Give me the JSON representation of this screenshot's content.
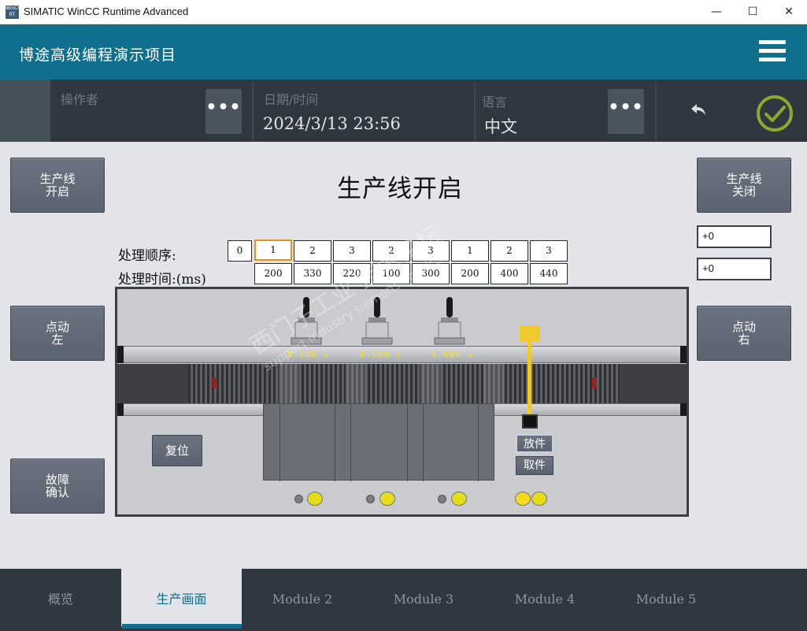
{
  "window": {
    "icon_text": "WinCC RT",
    "title": "SIMATIC WinCC Runtime Advanced",
    "minimize": "—",
    "maximize": "☐",
    "close": "✕"
  },
  "header": {
    "project_title": "博途高级编程演示项目"
  },
  "infobar": {
    "operator_label": "操作者",
    "operator_button": "•••",
    "datetime_label": "日期/时间",
    "datetime_value": "2024/3/13 23:56",
    "language_label": "语言",
    "language_value": "中文",
    "language_button": "•••"
  },
  "main": {
    "title": "生产线开启",
    "left_buttons": {
      "line_start": "生产线\n开启",
      "jog_left": "点动\n左",
      "fault_ack": "故障\n确认"
    },
    "right_buttons": {
      "line_stop": "生产线\n关闭",
      "jog_right": "点动\n右"
    },
    "right_fields": [
      "+0",
      "+0"
    ],
    "sequence_label": "处理顺序:",
    "time_label": "处理时间:(ms)",
    "sequence_index": "0",
    "sequence": [
      "1",
      "2",
      "3",
      "2",
      "3",
      "1",
      "2",
      "3"
    ],
    "times": [
      "200",
      "330",
      "220",
      "100",
      "300",
      "200",
      "400",
      "440"
    ]
  },
  "machine": {
    "timers": [
      "0.000  s",
      "0.000  s",
      "0.000  s"
    ],
    "reset_label": "复位",
    "place_label": "放件",
    "pick_label": "取件"
  },
  "watermark": {
    "line1": "西门子工业 技术论坛",
    "line2": "support.industry.siemens.com/cs"
  },
  "nav": {
    "tabs": [
      "概览",
      "生产画面",
      "Module 2",
      "Module 3",
      "Module 4",
      "Module 5"
    ],
    "active_index": 1
  }
}
